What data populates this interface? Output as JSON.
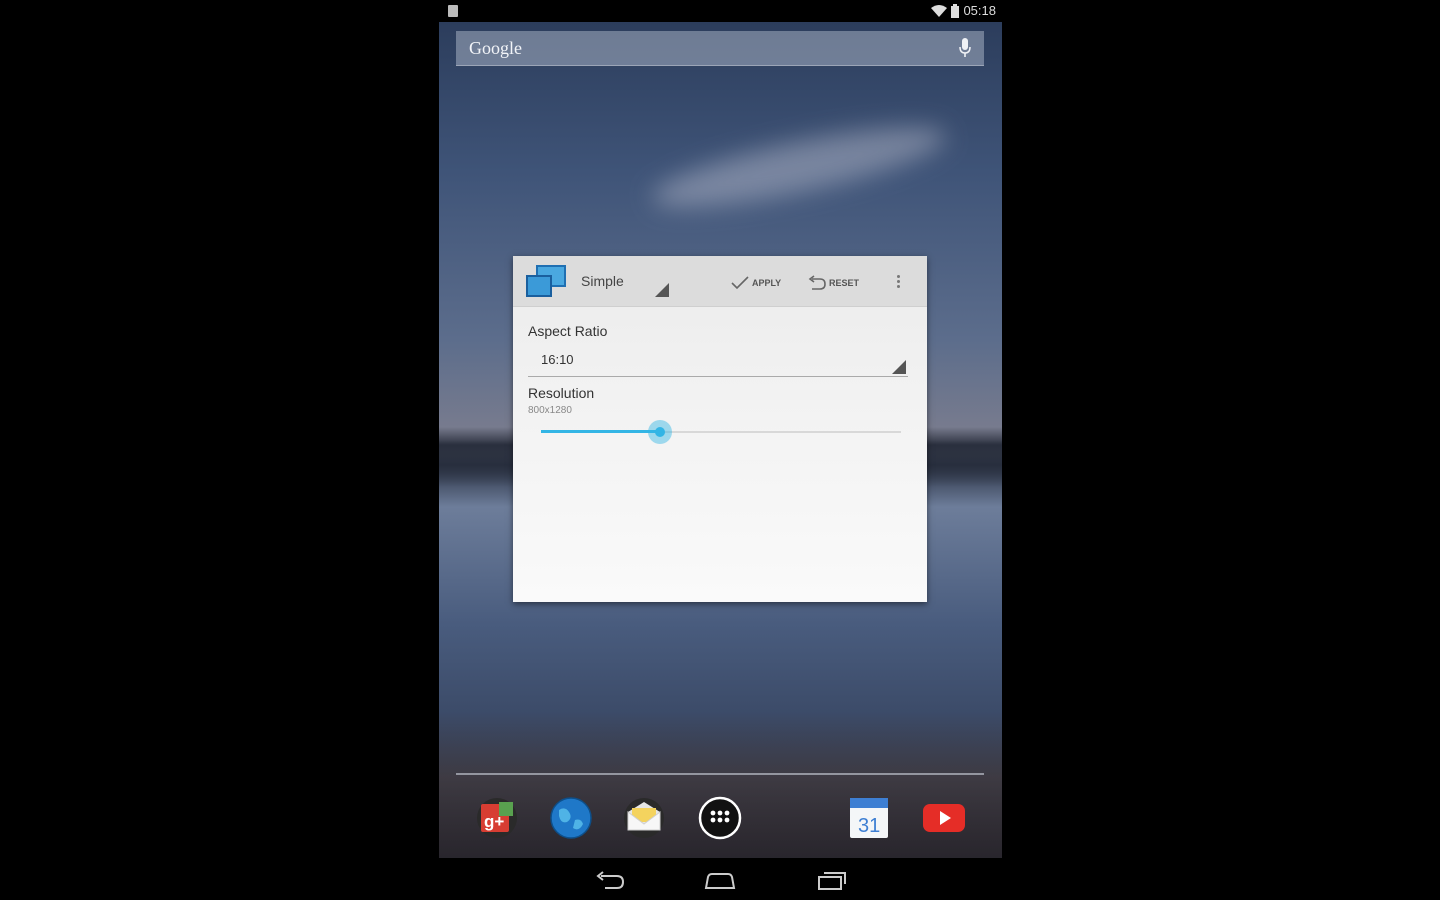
{
  "status_bar": {
    "time": "05:18"
  },
  "search": {
    "logo": "Google",
    "icon": "mic-icon"
  },
  "widget": {
    "mode": "Simple",
    "actions": {
      "apply": "APPLY",
      "reset": "RESET"
    },
    "aspect_ratio": {
      "label": "Aspect Ratio",
      "value": "16:10"
    },
    "resolution": {
      "label": "Resolution",
      "value": "800x1280",
      "slider_fraction": 0.33
    }
  },
  "dock": {
    "apps": [
      {
        "name": "google-plus-icon"
      },
      {
        "name": "browser-globe-icon"
      },
      {
        "name": "email-icon"
      },
      {
        "name": "app-drawer-icon"
      },
      {
        "name": "calendar-icon",
        "text": "31"
      },
      {
        "name": "youtube-icon"
      }
    ]
  },
  "nav": {
    "back": "back-icon",
    "home": "home-icon",
    "recents": "recents-icon"
  },
  "colors": {
    "accent": "#33b5e5",
    "youtube_red": "#e52d27"
  }
}
